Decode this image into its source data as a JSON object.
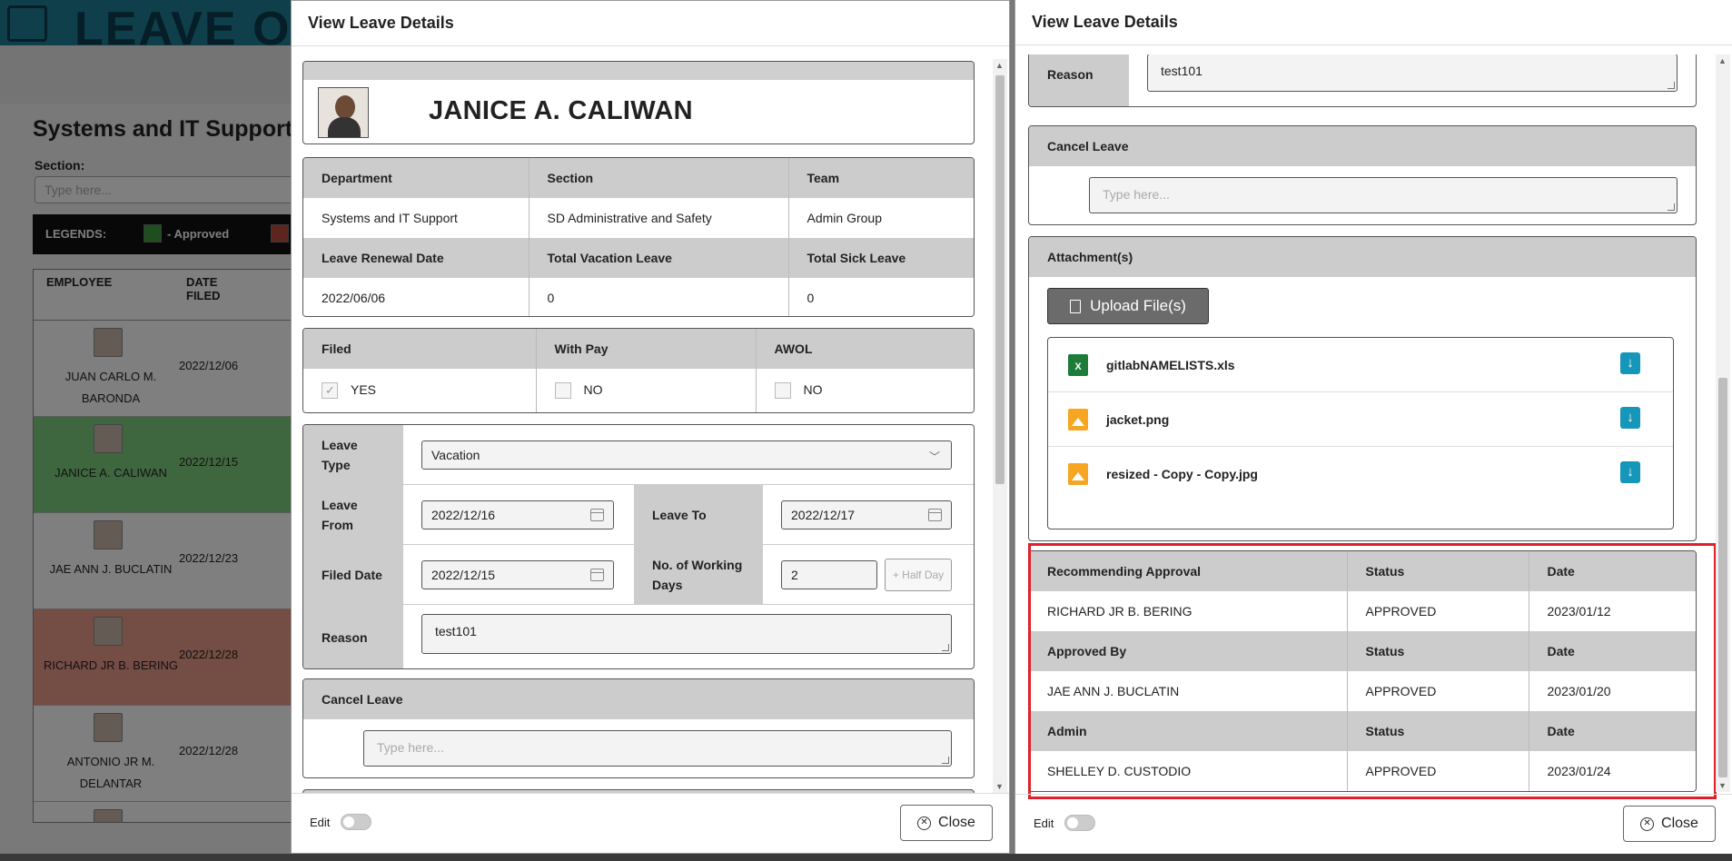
{
  "background": {
    "header_title": "LEAVE OF",
    "heading": "Systems and IT Support",
    "section_label": "Section:",
    "section_placeholder": "Type here...",
    "legends_label": "LEGENDS:",
    "legend_approved": "- Approved",
    "table_headers": {
      "employee": "EMPLOYEE",
      "date_filed": "DATE FILED"
    },
    "rows": [
      {
        "name": "JUAN CARLO M. BARONDA",
        "date": "2022/12/06",
        "status_color": "#ffffff"
      },
      {
        "name": "JANICE A. CALIWAN",
        "date": "2022/12/15",
        "status_color": "#7fcf7f"
      },
      {
        "name": "JAE ANN J. BUCLATIN",
        "date": "2022/12/23",
        "status_color": "#ffffff"
      },
      {
        "name": "RICHARD JR B. BERING",
        "date": "2022/12/28",
        "status_color": "#e99a8a"
      },
      {
        "name": "ANTONIO JR M. DELANTAR",
        "date": "2022/12/28",
        "status_color": "#ffffff"
      }
    ]
  },
  "modal_left": {
    "title": "View Leave Details",
    "employee_name": "JANICE A. CALIWAN",
    "info_headers": [
      "Department",
      "Section",
      "Team"
    ],
    "info_values": [
      "Systems and IT Support",
      "SD Administrative and Safety",
      "Admin Group"
    ],
    "leave_headers": [
      "Leave Renewal Date",
      "Total Vacation Leave",
      "Total Sick Leave"
    ],
    "leave_values": [
      "2022/06/06",
      "0",
      "0"
    ],
    "flags": {
      "filed_label": "Filed",
      "filed_value": "YES",
      "with_pay_label": "With Pay",
      "with_pay_value": "NO",
      "awol_label": "AWOL",
      "awol_value": "NO"
    },
    "form": {
      "leave_type_label": "Leave Type",
      "leave_type_value": "Vacation",
      "leave_from_label": "Leave From",
      "leave_from_value": "2022/12/16",
      "leave_to_label": "Leave To",
      "leave_to_value": "2022/12/17",
      "filed_date_label": "Filed Date",
      "filed_date_value": "2022/12/15",
      "working_days_label": "No. of Working Days",
      "working_days_value": "2",
      "half_day_label": "+ Half Day",
      "reason_label": "Reason",
      "reason_value": "test101"
    },
    "cancel_leave_label": "Cancel Leave",
    "cancel_placeholder": "Type here...",
    "edit_label": "Edit",
    "close_label": "Close"
  },
  "modal_right": {
    "title": "View Leave Details",
    "reason_label": "Reason",
    "reason_value": "test101",
    "cancel_leave_label": "Cancel Leave",
    "cancel_placeholder": "Type here...",
    "attachments_label": "Attachment(s)",
    "upload_label": "Upload File(s)",
    "files": [
      {
        "name": "gitlabNAMELISTS.xls",
        "icon": "excel-file-icon"
      },
      {
        "name": "jacket.png",
        "icon": "image-file-icon"
      },
      {
        "name": "resized - Copy - Copy.jpg",
        "icon": "image-file-icon"
      }
    ],
    "approvals": [
      {
        "role": "Recommending Approval",
        "status_header": "Status",
        "date_header": "Date",
        "name": "RICHARD JR B. BERING",
        "status": "APPROVED",
        "date": "2023/01/12"
      },
      {
        "role": "Approved By",
        "status_header": "Status",
        "date_header": "Date",
        "name": "JAE ANN J. BUCLATIN",
        "status": "APPROVED",
        "date": "2023/01/20"
      },
      {
        "role": "Admin",
        "status_header": "Status",
        "date_header": "Date",
        "name": "SHELLEY D. CUSTODIO",
        "status": "APPROVED",
        "date": "2023/01/24"
      }
    ],
    "edit_label": "Edit",
    "close_label": "Close",
    "highlight_color": "#e0202a"
  }
}
